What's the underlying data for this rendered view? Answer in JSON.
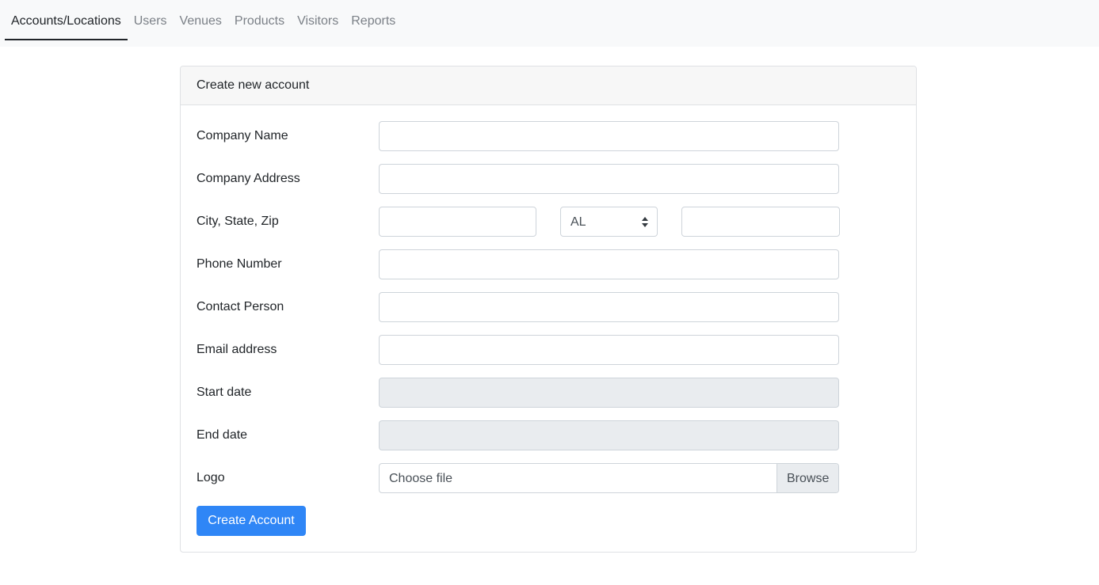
{
  "nav": {
    "tabs": [
      {
        "label": "Accounts/Locations",
        "active": true
      },
      {
        "label": "Users",
        "active": false
      },
      {
        "label": "Venues",
        "active": false
      },
      {
        "label": "Products",
        "active": false
      },
      {
        "label": "Visitors",
        "active": false
      },
      {
        "label": "Reports",
        "active": false
      }
    ]
  },
  "form": {
    "title": "Create new account",
    "fields": {
      "company_name": {
        "label": "Company Name",
        "value": ""
      },
      "company_address": {
        "label": "Company Address",
        "value": ""
      },
      "city_state_zip": {
        "label": "City, State, Zip",
        "city_value": "",
        "state_value": "AL",
        "zip_value": ""
      },
      "phone_number": {
        "label": "Phone Number",
        "value": ""
      },
      "contact_person": {
        "label": "Contact Person",
        "value": ""
      },
      "email_address": {
        "label": "Email address",
        "value": ""
      },
      "start_date": {
        "label": "Start date",
        "value": ""
      },
      "end_date": {
        "label": "End date",
        "value": ""
      },
      "logo": {
        "label": "Logo",
        "placeholder": "Choose file",
        "browse_label": "Browse"
      }
    },
    "submit_label": "Create Account"
  },
  "colors": {
    "primary": "#2f86f6",
    "nav_background": "#f8f9fa",
    "disabled_input": "#e9ecef"
  }
}
